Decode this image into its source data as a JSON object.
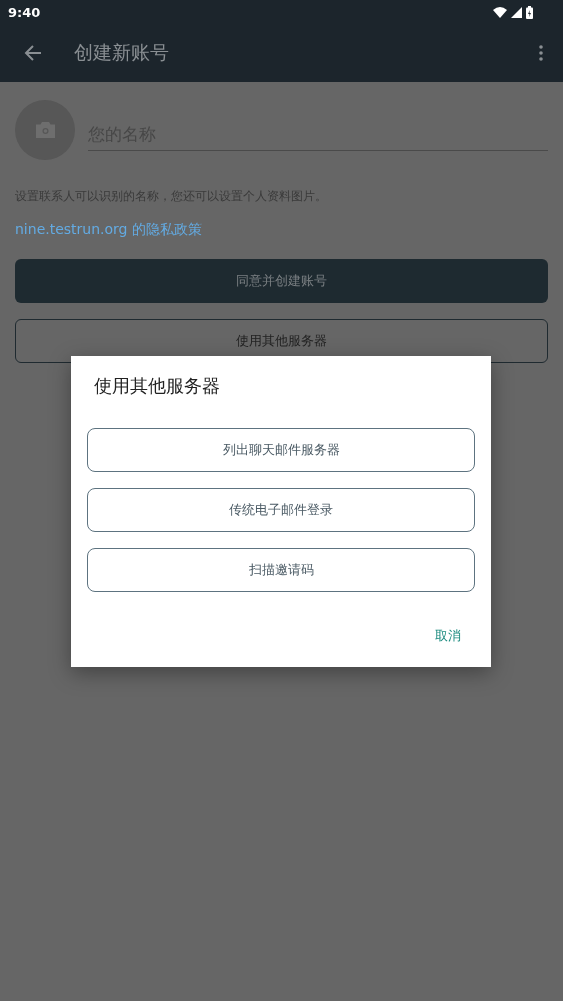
{
  "status_bar": {
    "time": "9:40"
  },
  "toolbar": {
    "title": "创建新账号"
  },
  "profile": {
    "name_placeholder": "您的名称",
    "hint": "设置联系人可以识别的名称，您还可以设置个人资料图片。",
    "privacy_link": "nine.testrun.org 的隐私政策"
  },
  "buttons": [
    {
      "label": "同意并创建账号",
      "kind": "filled"
    },
    {
      "label": "使用其他服务器",
      "kind": "outlined"
    }
  ],
  "dialog": {
    "title": "使用其他服务器",
    "options": [
      "列出聊天邮件服务器",
      "传统电子邮件登录",
      "扫描邀请码"
    ],
    "cancel": "取消"
  }
}
